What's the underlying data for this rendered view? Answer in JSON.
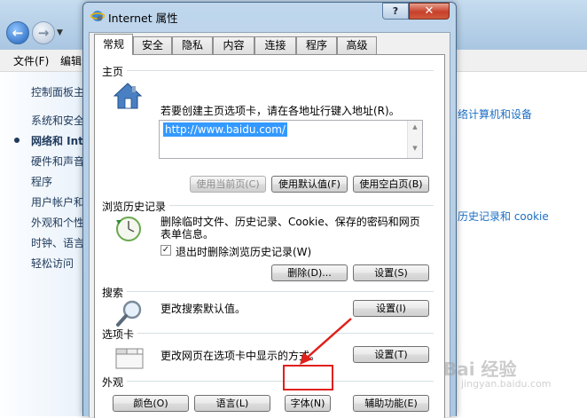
{
  "background": {
    "nav": {
      "back_glyph": "←",
      "forward_glyph": "→",
      "dropdown_glyph": "▼"
    },
    "menu": [
      "文件(F)",
      "编辑"
    ],
    "sidebar": {
      "links": [
        "控制面板主",
        "系统和安全",
        "网络和 Int",
        "硬件和声音",
        "程序",
        "用户帐户和",
        "外观和个性",
        "时钟、语言",
        "轻松访问"
      ],
      "active_index": 2
    },
    "right_links": [
      "络计算机和设备",
      "历史记录和 cookie"
    ]
  },
  "dialog": {
    "title": "Internet 属性",
    "help_glyph": "?",
    "close_glyph": "✕",
    "tabs": [
      "常规",
      "安全",
      "隐私",
      "内容",
      "连接",
      "程序",
      "高级"
    ],
    "selected_tab": 0,
    "home": {
      "title": "主页",
      "description": "若要创建主页选项卡，请在各地址行键入地址(R)。",
      "url": "http://www.baidu.com/",
      "buttons": {
        "current": "使用当前页(C)",
        "default": "使用默认值(F)",
        "blank": "使用空白页(B)"
      }
    },
    "history": {
      "title": "浏览历史记录",
      "description_line1": "删除临时文件、历史记录、Cookie、保存的密码和网页",
      "description_line2": "表单信息。",
      "checkbox_label": "退出时删除浏览历史记录(W)",
      "checkbox_checked": true,
      "check_glyph": "✓",
      "buttons": {
        "delete": "删除(D)...",
        "settings": "设置(S)"
      }
    },
    "search": {
      "title": "搜索",
      "description": "更改搜索默认值。",
      "buttons": {
        "settings": "设置(I)"
      }
    },
    "tabs_section": {
      "title": "选项卡",
      "description": "更改网页在选项卡中显示的方式。",
      "buttons": {
        "settings": "设置(T)"
      }
    },
    "appearance": {
      "title": "外观",
      "buttons": {
        "colors": "颜色(O)",
        "languages": "语言(L)",
        "fonts": "字体(N)",
        "accessibility": "辅助功能(E)"
      }
    }
  },
  "watermark": {
    "text": "Bai 经验",
    "url": "jingyan.baidu.com"
  },
  "colors": {
    "annotation": "#e0201b",
    "selection": "#3399ff",
    "link": "#1c6ec4"
  }
}
